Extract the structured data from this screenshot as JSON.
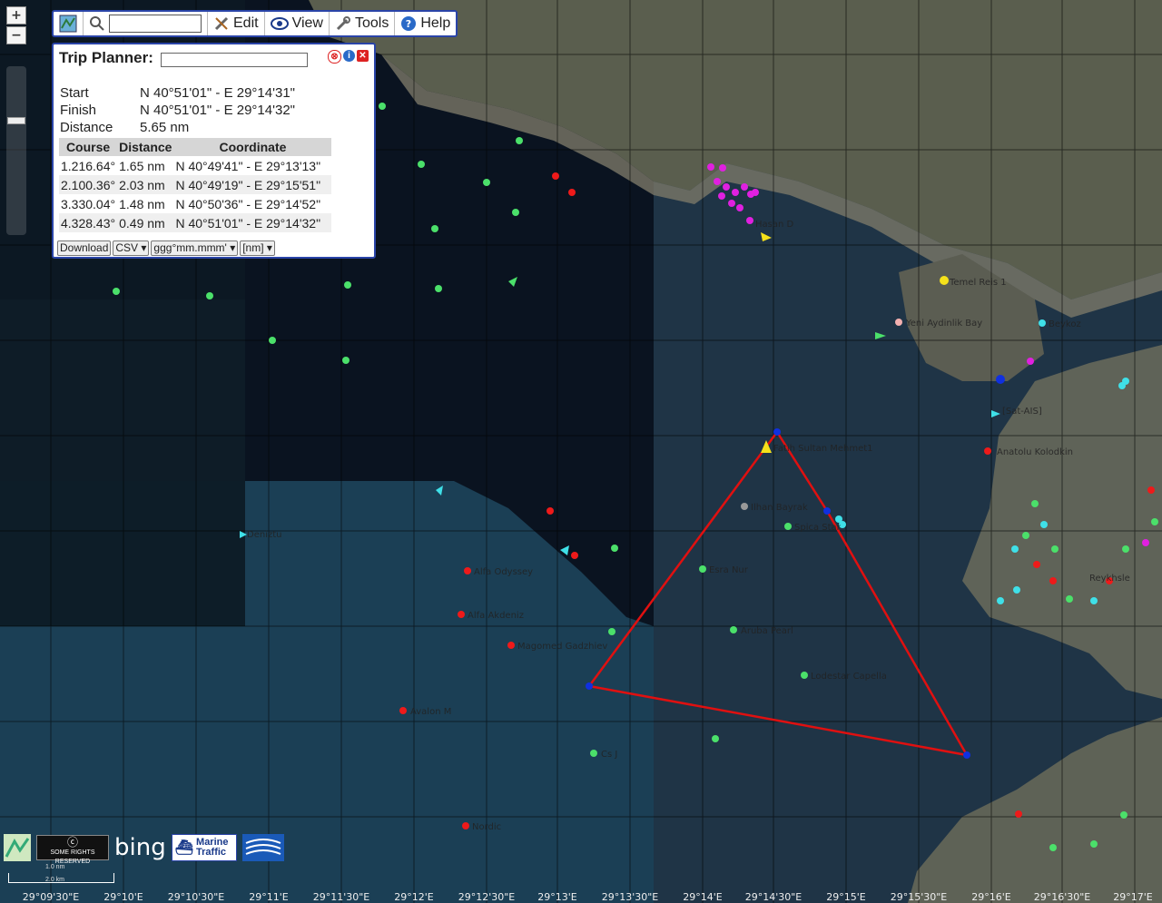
{
  "toolbar": {
    "search_value": "",
    "edit_label": "Edit",
    "view_label": "View",
    "tools_label": "Tools",
    "help_label": "Help"
  },
  "zoom": {
    "plus": "+",
    "minus": "−"
  },
  "trip_planner": {
    "title": "Trip Planner:",
    "name_value": "",
    "start_label": "Start",
    "start_value": "N 40°51'01\" - E 29°14'31\"",
    "finish_label": "Finish",
    "finish_value": "N 40°51'01\" - E 29°14'32\"",
    "distance_label": "Distance",
    "distance_value": "5.65 nm",
    "headers": [
      "Course",
      "Distance",
      "Coordinate"
    ],
    "legs": [
      {
        "course": "1.216.64°",
        "distance": "1.65 nm",
        "coordinate": "N 40°49'41\" - E 29°13'13\""
      },
      {
        "course": "2.100.36°",
        "distance": "2.03 nm",
        "coordinate": "N 40°49'19\" - E 29°15'51\""
      },
      {
        "course": "3.330.04°",
        "distance": "1.48 nm",
        "coordinate": "N 40°50'36\" - E 29°14'52\""
      },
      {
        "course": "4.328.43°",
        "distance": "0.49 nm",
        "coordinate": "N 40°51'01\" - E 29°14'32\""
      }
    ],
    "download_label": "Download",
    "format_value": "CSV",
    "coord_format_value": "ggg°mm.mmm'",
    "unit_value": "[nm]"
  },
  "vessels": [
    "Fatih Sultan Mehmet1",
    "Ilhan Bayrak",
    "Spica Star",
    "Esra Nur",
    "Aruba Pearl",
    "Lodestar Capella",
    "Alfa Odyssey",
    "Alfa Akdeniz",
    "Magomed Gadzhiev",
    "Avalon M",
    "Cs J",
    "Nordic",
    "Anatolu Kolodkin",
    "Temel Reis 1",
    "[Sat-AIS]",
    "Deniztu",
    "Hasan D",
    "Yeni Aydinlik Bay",
    "Beykoz",
    "Reykhsle"
  ],
  "lon_labels": [
    "29°09'30\"E",
    "29°10'E",
    "29°10'30\"E",
    "29°11'E",
    "29°11'30\"E",
    "29°12'E",
    "29°12'30\"E",
    "29°13'E",
    "29°13'30\"E",
    "29°14'E",
    "29°14'30\"E",
    "29°15'E",
    "29°15'30\"E",
    "29°16'E",
    "29°16'30\"E",
    "29°17'E"
  ],
  "logos": {
    "cc": "SOME RIGHTS RESERVED",
    "bing": "bing",
    "marine": "Marine",
    "traffic": "Traffic"
  },
  "scale": {
    "top": "1.0 nm",
    "bottom": "2.0 km"
  },
  "colors": {
    "route": "#e01010",
    "waypoint": "#1030e0",
    "panel_border": "#2a44a8",
    "sea": "#1e3446"
  }
}
